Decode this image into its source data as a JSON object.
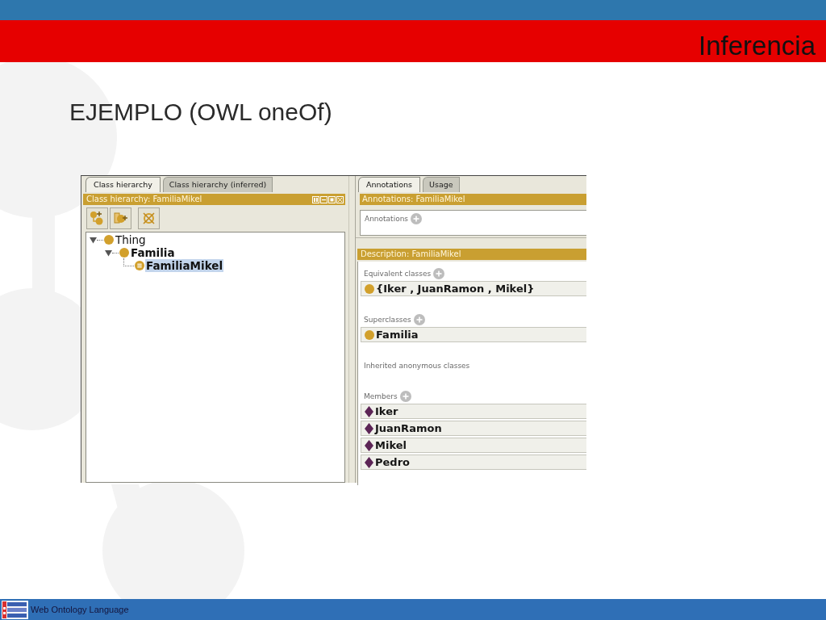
{
  "header": {
    "title": "Inferencia"
  },
  "slide_title": "EJEMPLO (OWL oneOf)",
  "class_hierarchy": {
    "tabs": [
      {
        "label": "Class hierarchy",
        "selected": true
      },
      {
        "label": "Class hierarchy (inferred)",
        "selected": false
      }
    ],
    "title": "Class hierarchy: FamiliaMikel",
    "tree": [
      {
        "label": "Thing",
        "kind": "class",
        "bold": false,
        "expanded": true,
        "selected": false,
        "children": [
          {
            "label": "Familia",
            "kind": "class",
            "bold": true,
            "expanded": true,
            "selected": false,
            "children": [
              {
                "label": "FamiliaMikel",
                "kind": "defined_class",
                "bold": true,
                "selected": true
              }
            ]
          }
        ]
      }
    ]
  },
  "class_details": {
    "tabs": [
      {
        "label": "Annotations",
        "selected": true
      },
      {
        "label": "Usage",
        "selected": false
      }
    ],
    "annotations_title": "Annotations: FamiliaMikel",
    "annotations": {
      "label": "Annotations",
      "addable": true
    },
    "description_title": "Description: FamiliaMikel",
    "sections": [
      {
        "label": "Equivalent classes",
        "addable": true,
        "items": [
          {
            "kind": "class",
            "label": "{Iker , JuanRamon , Mikel}"
          }
        ]
      },
      {
        "label": "Superclasses",
        "addable": true,
        "items": [
          {
            "kind": "class",
            "label": "Familia"
          }
        ]
      },
      {
        "label": "Inherited anonymous classes",
        "addable": false
      },
      {
        "label": "Members",
        "addable": true,
        "items": [
          {
            "kind": "individual",
            "label": "Iker"
          },
          {
            "kind": "individual",
            "label": "JuanRamon"
          },
          {
            "kind": "individual",
            "label": "Mikel"
          },
          {
            "kind": "individual",
            "label": "Pedro"
          }
        ]
      }
    ]
  },
  "footer": {
    "text": "Web Ontology Language"
  }
}
